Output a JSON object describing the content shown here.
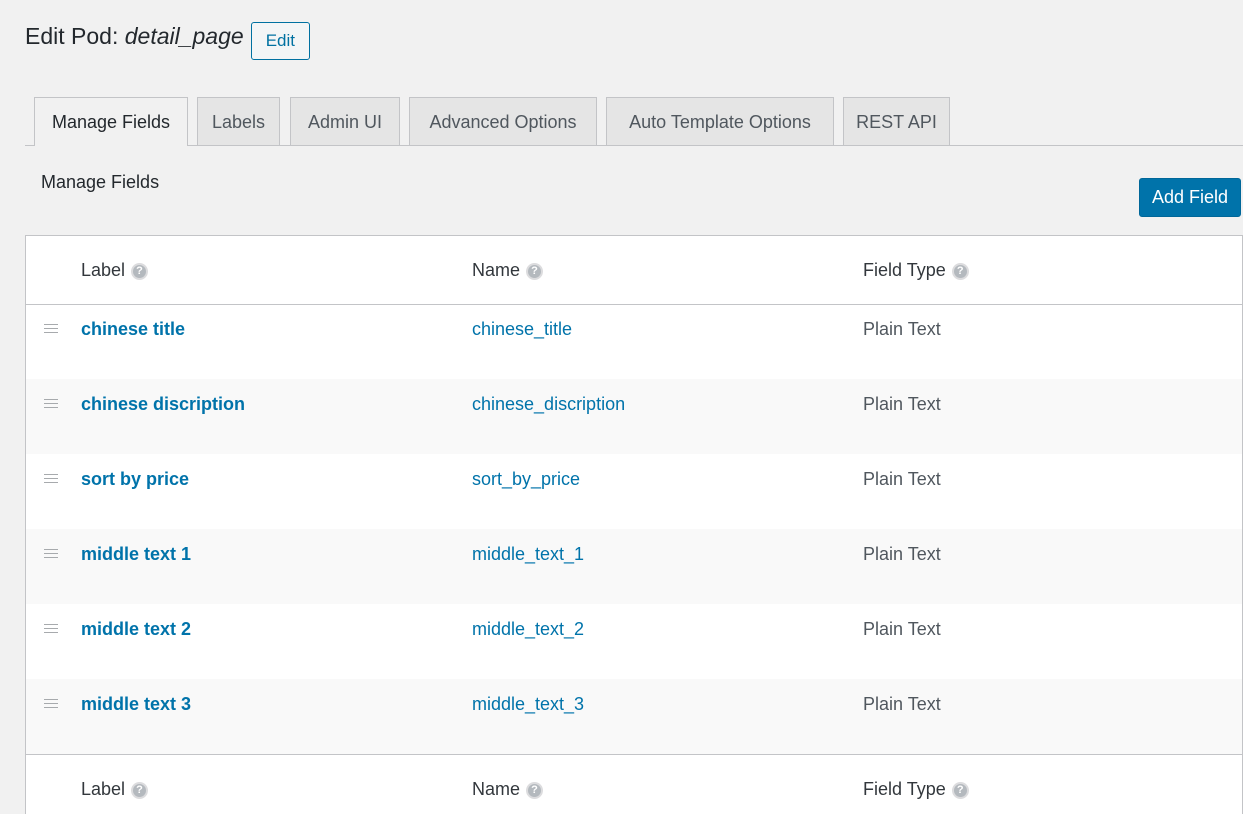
{
  "header": {
    "title_prefix": "Edit Pod: ",
    "pod_name": "detail_page",
    "edit_label": "Edit"
  },
  "tabs": [
    {
      "label": "Manage Fields",
      "active": true
    },
    {
      "label": "Labels",
      "active": false
    },
    {
      "label": "Admin UI",
      "active": false
    },
    {
      "label": "Advanced Options",
      "active": false
    },
    {
      "label": "Auto Template Options",
      "active": false
    },
    {
      "label": "REST API",
      "active": false
    }
  ],
  "section": {
    "title": "Manage Fields",
    "add_field_label": "Add Field"
  },
  "table": {
    "columns": {
      "label": "Label",
      "name": "Name",
      "field_type": "Field Type"
    },
    "help_icon": "question-mark-icon",
    "help_glyph": "?",
    "rows": [
      {
        "label": "chinese title",
        "name": "chinese_title",
        "type": "Plain Text"
      },
      {
        "label": "chinese discription",
        "name": "chinese_discription",
        "type": "Plain Text"
      },
      {
        "label": "sort by price",
        "name": "sort_by_price",
        "type": "Plain Text"
      },
      {
        "label": "middle text 1",
        "name": "middle_text_1",
        "type": "Plain Text"
      },
      {
        "label": "middle text 2",
        "name": "middle_text_2",
        "type": "Plain Text"
      },
      {
        "label": "middle text 3",
        "name": "middle_text_3",
        "type": "Plain Text"
      }
    ]
  },
  "colors": {
    "accent": "#0073aa",
    "page_background": "#f1f1f1"
  }
}
